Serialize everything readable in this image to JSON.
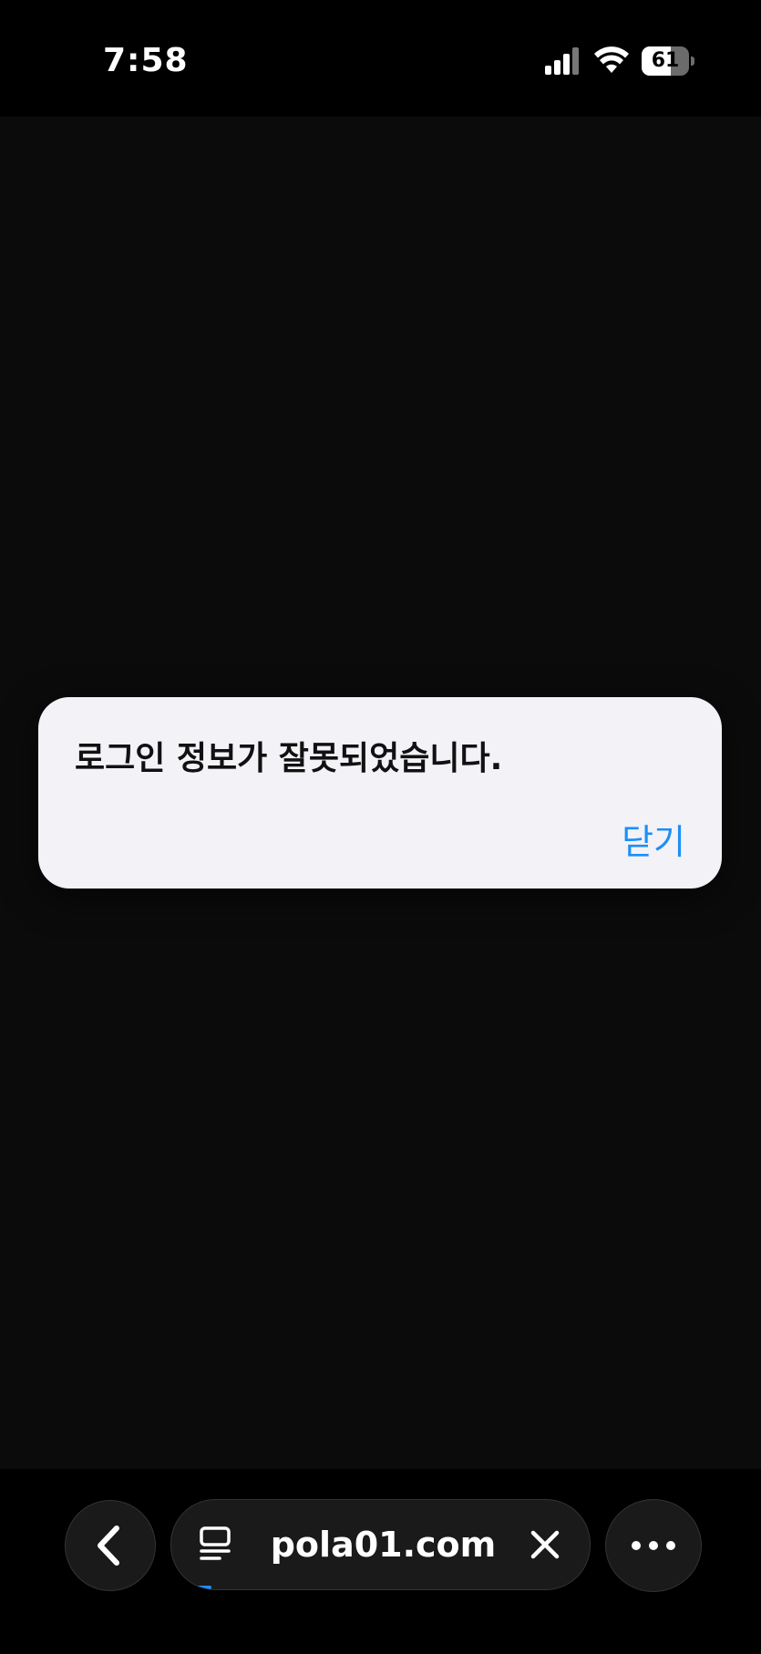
{
  "status_bar": {
    "time": "7:58",
    "battery_level": "61",
    "battery_fraction": 0.61,
    "icons": [
      "signal-icon",
      "wifi-icon",
      "battery-icon"
    ]
  },
  "alert": {
    "message": "로그인 정보가 잘못되었습니다.",
    "close_label": "닫기"
  },
  "browser_bar": {
    "url": "pola01.com",
    "icons": [
      "back-chevron-icon",
      "tab-icon",
      "clear-icon",
      "more-icon"
    ]
  },
  "colors": {
    "accent": "#1e8ef5",
    "background": "#0b0b0b",
    "dialog": "#f2f2f7"
  }
}
